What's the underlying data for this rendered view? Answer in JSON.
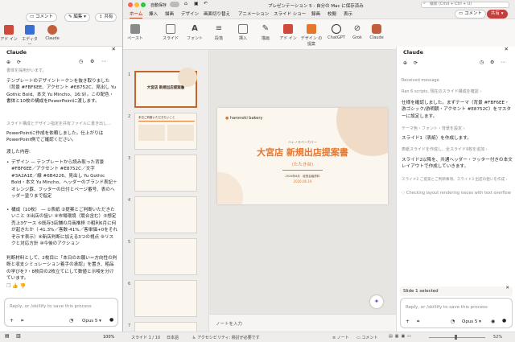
{
  "left": {
    "toolbar": {
      "comment": "コメント",
      "edit": "編集",
      "share": "共有",
      "addins": "アド\nイン",
      "editor": "エディター",
      "claude": "Claude"
    },
    "panel_title": "Claude",
    "cut_text": "書体を採用がいます。",
    "p1": "テンプレートのデザイントークンを抜き取りました（背景 #FBF6EE、アクセント #E8752C、見出し Yu Gothic Bold、本文 Yu Mincho、16:9）。この配色・書体と10枚の構成をPowerPointに渡します。",
    "link1": "スライド構成とデザイン指定を共有ファイルに書き出し...",
    "p2": "PowerPointに作成を依頼しました。仕上がりはPowerPoint側でご確認ください。",
    "p3": "渡した内容:",
    "b1": "デザイン — テンプレートから読み取った背景 #FBF6EE／アクセント #E8752C／文字 #3A2A1E／線 #6B4226、見出し Yu Gothic Bold・本文 Yu Mincho、ヘッダーのブランド表記＋オレンジ罫、フッターの日付とページ番号、表のヘッダー塗りまで指定",
    "b2": "構成（10枚） — ①表紙 ②提案とご判断いただきたいこと ③出店の狙い ④市場環境（競合含む）⑤想定売上3ケース ⑥既存3店舗の月商推移 ⑦粗利6月に何が起きたか（-41.3%／客数-41%／客単価+0をそれぞ示す表示）⑧新店判断に加える3つの視点 ⑨リスクと対応方針 ⑩今後のアクション",
    "p4": "判断材料として、2枚目に「本日のお願い＝方向性の判断と収支シミュレーション着手の承認」を置き、粗品の学びを7・8枚目の2枚立てにして数値と示唆を分けています。",
    "input_placeholder": "Reply, or /skillify to save this process",
    "model": "Opus 5",
    "zoom": "100%"
  },
  "main": {
    "autosave": "自動保存",
    "title": "プレゼンテーション 5 - 自分の Mac に保存済み",
    "search": "検索 (Cmd + Ctrl + U)",
    "tabs": [
      "ホーム",
      "挿入",
      "描画",
      "デザイン",
      "画面切り替え",
      "アニメーション",
      "スライド ショー",
      "録画",
      "校閲",
      "表示"
    ],
    "comment_btn": "コメント",
    "share_btn": "共有",
    "ribbon": [
      "ペースト",
      "スライド",
      "フォント",
      "段落",
      "挿入",
      "描画",
      "アド\nイン",
      "デザイン\nの提案",
      "ChatGPT",
      "Grok",
      "Claude"
    ],
    "thumb_numbers": [
      "1",
      "2",
      "3",
      "4",
      "5",
      "6",
      "7",
      "8"
    ],
    "thumb1_title": "大宮店 新規出店提案書",
    "thumb2_title": "本日ご判断いただきたいこと",
    "slide": {
      "brand": "haronoki bakery",
      "kicker": "ハレノキベーカリー",
      "title": "大宮店 新規出店提案書",
      "subtitle": "(たたき台)",
      "date_line": "2026年6月　経営会議資料",
      "date": "2026.06.19"
    },
    "notes_placeholder": "ノートを入力",
    "status": {
      "slide_of": "スライド 1 / 10",
      "lang": "日本語",
      "accessibility": "アクセシビリティ: 検討が必要です",
      "notes": "ノート",
      "comments": "コメント",
      "zoom": "52%"
    }
  },
  "right": {
    "panel_title": "Claude",
    "received": "Received message",
    "ran": "Ran 6 scripts, 現在のスライド構成を確認 ›",
    "p1": "仕様を確認しました。まずテーマ（背景 #FBF6EE・游ゴシック/游明朝・アクセント #E8752C）をマスターに設定します。",
    "link_theme": "テーマ色・フォント・背景を設定 ›",
    "p2": "スライド1（表紙）を作成します。",
    "link_cover": "表紙スライドを作成し、全スライド9枚を追加 ›",
    "p3": "スライド2以降を、共通ヘッダー・フッター付きの本文レイアウトで作成していきます。",
    "link_s2": "スライド2 ご提案とご判断事項、スライド3 出店の狙いを作成 ›",
    "checking": "Checking layout rendering issues with text overflow",
    "selected": "Slide 1 selected",
    "input_placeholder": "Reply, or /skillify to save this process",
    "model": "Opus 5"
  },
  "colors": {
    "accent": "#E8752C",
    "slide_bg": "#FBF6EE",
    "text": "#3A2A1E",
    "line": "#6B4226",
    "claude": "#c15f3c"
  }
}
